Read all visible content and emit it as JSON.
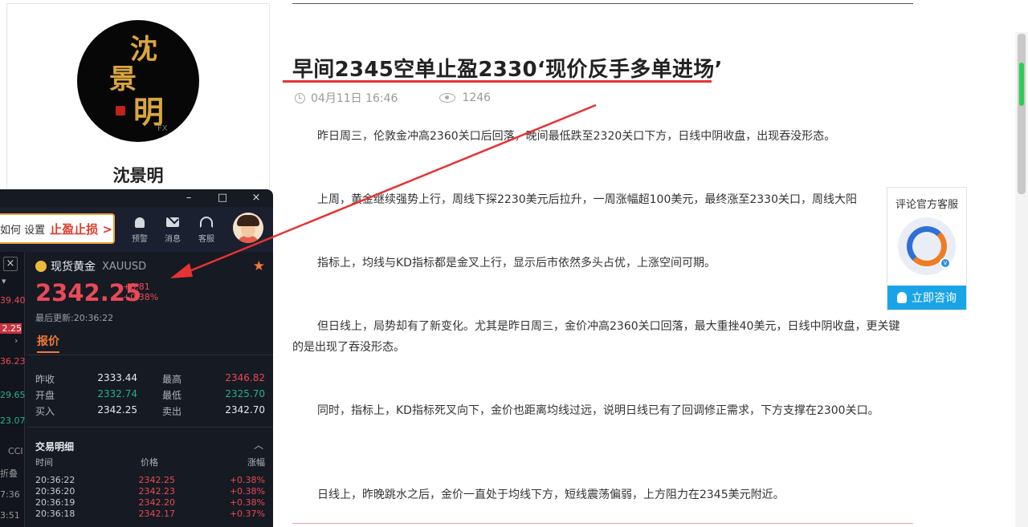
{
  "author": {
    "logo_chars": [
      "沈",
      "景",
      "明"
    ],
    "logo_watermark": "FX",
    "name": "沈景明"
  },
  "article": {
    "title": "早间2345空单止盈2330‘现价反手多单进场’",
    "date": "04月11日 16:46",
    "views": "1246",
    "paragraphs": [
      "昨日周三，伦敦金冲高2360关口后回落，晚间最低跌至2320关口下方，日线中阴收盘，出现吞没形态。",
      "上周，黄金继续强势上行，周线下探2230美元后拉升，一周涨幅超100美元，最终涨至2330关口，周线大阳",
      "指标上，均线与KD指标都是金叉上行，显示后市依然多头占优，上涨空间可期。",
      "但日线上，局势却有了新变化。尤其是昨日周三，金价冲高2360关口回落，最大重挫40美元，日线中阴收盘，更关键的是出现了吞没形态。",
      "同时，指标上，KD指标死叉向下，金价也距离均线过远，说明日线已有了回调修正需求，下方支撑在2300关口。",
      "日线上，昨晚跳水之后，金价一直处于均线下方，短线震荡偏弱，上方阻力在2345美元附近。"
    ]
  },
  "service_widget": {
    "label": "评论官方客服",
    "button": "立即咨询",
    "accent": "#1aa4e8"
  },
  "app": {
    "window": {
      "minimize": "–",
      "maximize": "□",
      "close": "×"
    },
    "promo": {
      "prefix": "如何 设置",
      "highlight": "止盈止损 >"
    },
    "header_items": [
      {
        "label": "预警",
        "icon": "bell-icon"
      },
      {
        "label": "消息",
        "icon": "mail-icon"
      },
      {
        "label": "客服",
        "icon": "headset-icon"
      }
    ],
    "left_strip": {
      "close": "×",
      "values": [
        "39.40",
        "2.25",
        "36.23",
        "29.65",
        "23.07"
      ],
      "labels": [
        "CCI",
        "折叠",
        "7:36",
        "3:51"
      ]
    },
    "quote": {
      "name": "现货黄金",
      "symbol": "XAUUSD",
      "price": "2342.25",
      "change": "+8.81",
      "change_pct": "+0.38%",
      "updated": "最后更新:20:36:22",
      "tab": "报价",
      "rows": [
        {
          "l1": "昨收",
          "v1": "2333.44",
          "l2": "最高",
          "v2": "2346.82"
        },
        {
          "l1": "开盘",
          "v1": "2332.74",
          "l2": "最低",
          "v2": "2325.70"
        },
        {
          "l1": "买入",
          "v1": "2342.25",
          "l2": "卖出",
          "v2": "2342.70"
        }
      ],
      "up_color": "#e84a57",
      "down_color": "#26b08a"
    },
    "trades": {
      "title": "交易明细",
      "headers": {
        "time": "时间",
        "price": "价格",
        "change": "涨幅"
      },
      "rows": [
        {
          "time": "20:36:22",
          "price": "2342.25",
          "change": "+0.38%"
        },
        {
          "time": "20:36:20",
          "price": "2342.23",
          "change": "+0.38%"
        },
        {
          "time": "20:36:19",
          "price": "2342.20",
          "change": "+0.38%"
        },
        {
          "time": "20:36:18",
          "price": "2342.17",
          "change": "+0.37%"
        }
      ]
    }
  }
}
